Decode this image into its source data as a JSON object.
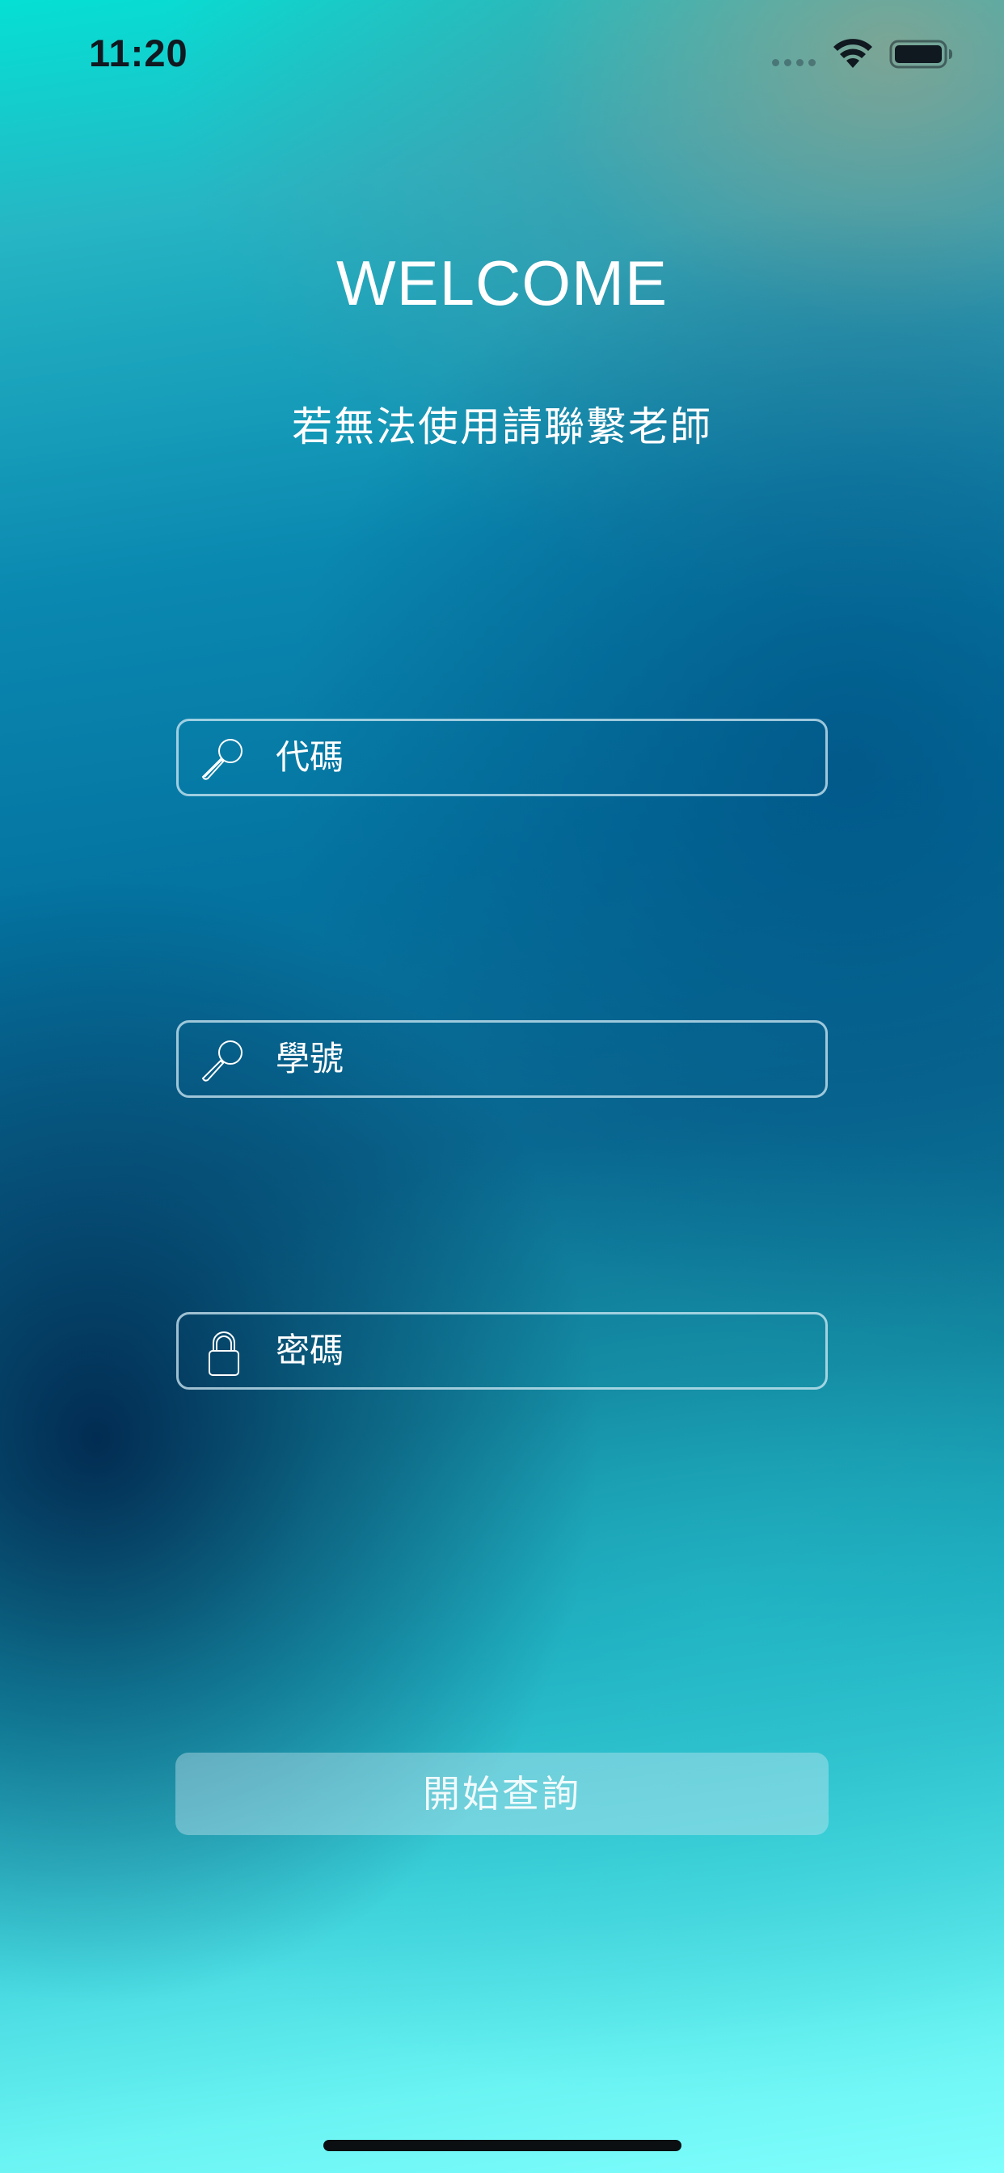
{
  "status_bar": {
    "time": "11:20"
  },
  "header": {
    "title": "WELCOME",
    "subtitle": "若無法使用請聯繫老師"
  },
  "form": {
    "code_field": {
      "placeholder": "代碼",
      "value": "",
      "icon": "magnifier-icon"
    },
    "student_id_field": {
      "placeholder": "學號",
      "value": "",
      "icon": "magnifier-icon"
    },
    "password_field": {
      "placeholder": "密碼",
      "value": "",
      "icon": "lock-icon"
    },
    "submit_label": "開始查詢"
  },
  "colors": {
    "top_accent": "#05e0d4",
    "mid_background": "#0473a0",
    "bottom_accent": "#7ffefd",
    "text": "#ffffff"
  }
}
